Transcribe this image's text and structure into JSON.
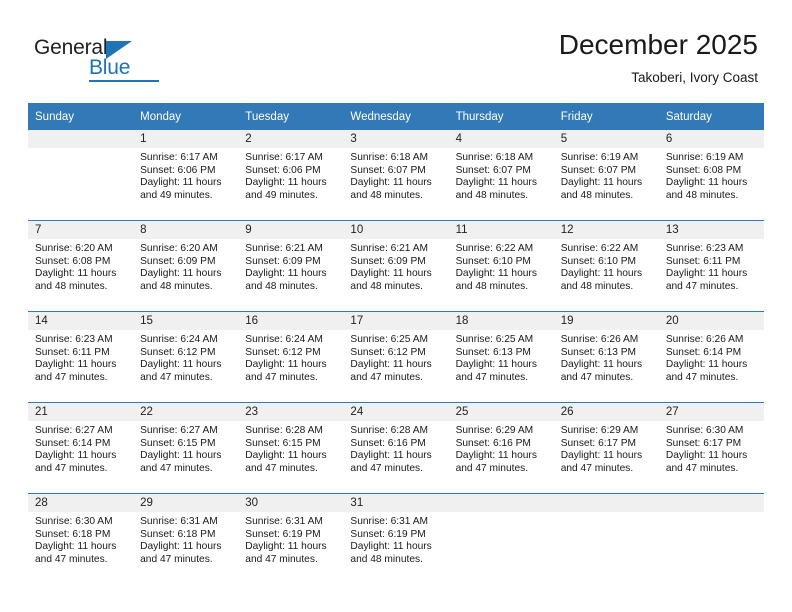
{
  "logo": {
    "word_top": "General",
    "word_bottom": "Blue",
    "accent_color": "#1f73b7",
    "triangle_icon": "triangle-icon"
  },
  "header": {
    "title": "December 2025",
    "subtitle": "Takoberi, Ivory Coast"
  },
  "calendar": {
    "header_bg": "#3279b7",
    "daynum_bg": "#f0f0f0",
    "weekday_headers": [
      "Sunday",
      "Monday",
      "Tuesday",
      "Wednesday",
      "Thursday",
      "Friday",
      "Saturday"
    ],
    "weeks": [
      [
        {
          "day": "",
          "lines": []
        },
        {
          "day": "1",
          "lines": [
            "Sunrise: 6:17 AM",
            "Sunset: 6:06 PM",
            "Daylight: 11 hours",
            "and 49 minutes."
          ]
        },
        {
          "day": "2",
          "lines": [
            "Sunrise: 6:17 AM",
            "Sunset: 6:06 PM",
            "Daylight: 11 hours",
            "and 49 minutes."
          ]
        },
        {
          "day": "3",
          "lines": [
            "Sunrise: 6:18 AM",
            "Sunset: 6:07 PM",
            "Daylight: 11 hours",
            "and 48 minutes."
          ]
        },
        {
          "day": "4",
          "lines": [
            "Sunrise: 6:18 AM",
            "Sunset: 6:07 PM",
            "Daylight: 11 hours",
            "and 48 minutes."
          ]
        },
        {
          "day": "5",
          "lines": [
            "Sunrise: 6:19 AM",
            "Sunset: 6:07 PM",
            "Daylight: 11 hours",
            "and 48 minutes."
          ]
        },
        {
          "day": "6",
          "lines": [
            "Sunrise: 6:19 AM",
            "Sunset: 6:08 PM",
            "Daylight: 11 hours",
            "and 48 minutes."
          ]
        }
      ],
      [
        {
          "day": "7",
          "lines": [
            "Sunrise: 6:20 AM",
            "Sunset: 6:08 PM",
            "Daylight: 11 hours",
            "and 48 minutes."
          ]
        },
        {
          "day": "8",
          "lines": [
            "Sunrise: 6:20 AM",
            "Sunset: 6:09 PM",
            "Daylight: 11 hours",
            "and 48 minutes."
          ]
        },
        {
          "day": "9",
          "lines": [
            "Sunrise: 6:21 AM",
            "Sunset: 6:09 PM",
            "Daylight: 11 hours",
            "and 48 minutes."
          ]
        },
        {
          "day": "10",
          "lines": [
            "Sunrise: 6:21 AM",
            "Sunset: 6:09 PM",
            "Daylight: 11 hours",
            "and 48 minutes."
          ]
        },
        {
          "day": "11",
          "lines": [
            "Sunrise: 6:22 AM",
            "Sunset: 6:10 PM",
            "Daylight: 11 hours",
            "and 48 minutes."
          ]
        },
        {
          "day": "12",
          "lines": [
            "Sunrise: 6:22 AM",
            "Sunset: 6:10 PM",
            "Daylight: 11 hours",
            "and 48 minutes."
          ]
        },
        {
          "day": "13",
          "lines": [
            "Sunrise: 6:23 AM",
            "Sunset: 6:11 PM",
            "Daylight: 11 hours",
            "and 47 minutes."
          ]
        }
      ],
      [
        {
          "day": "14",
          "lines": [
            "Sunrise: 6:23 AM",
            "Sunset: 6:11 PM",
            "Daylight: 11 hours",
            "and 47 minutes."
          ]
        },
        {
          "day": "15",
          "lines": [
            "Sunrise: 6:24 AM",
            "Sunset: 6:12 PM",
            "Daylight: 11 hours",
            "and 47 minutes."
          ]
        },
        {
          "day": "16",
          "lines": [
            "Sunrise: 6:24 AM",
            "Sunset: 6:12 PM",
            "Daylight: 11 hours",
            "and 47 minutes."
          ]
        },
        {
          "day": "17",
          "lines": [
            "Sunrise: 6:25 AM",
            "Sunset: 6:12 PM",
            "Daylight: 11 hours",
            "and 47 minutes."
          ]
        },
        {
          "day": "18",
          "lines": [
            "Sunrise: 6:25 AM",
            "Sunset: 6:13 PM",
            "Daylight: 11 hours",
            "and 47 minutes."
          ]
        },
        {
          "day": "19",
          "lines": [
            "Sunrise: 6:26 AM",
            "Sunset: 6:13 PM",
            "Daylight: 11 hours",
            "and 47 minutes."
          ]
        },
        {
          "day": "20",
          "lines": [
            "Sunrise: 6:26 AM",
            "Sunset: 6:14 PM",
            "Daylight: 11 hours",
            "and 47 minutes."
          ]
        }
      ],
      [
        {
          "day": "21",
          "lines": [
            "Sunrise: 6:27 AM",
            "Sunset: 6:14 PM",
            "Daylight: 11 hours",
            "and 47 minutes."
          ]
        },
        {
          "day": "22",
          "lines": [
            "Sunrise: 6:27 AM",
            "Sunset: 6:15 PM",
            "Daylight: 11 hours",
            "and 47 minutes."
          ]
        },
        {
          "day": "23",
          "lines": [
            "Sunrise: 6:28 AM",
            "Sunset: 6:15 PM",
            "Daylight: 11 hours",
            "and 47 minutes."
          ]
        },
        {
          "day": "24",
          "lines": [
            "Sunrise: 6:28 AM",
            "Sunset: 6:16 PM",
            "Daylight: 11 hours",
            "and 47 minutes."
          ]
        },
        {
          "day": "25",
          "lines": [
            "Sunrise: 6:29 AM",
            "Sunset: 6:16 PM",
            "Daylight: 11 hours",
            "and 47 minutes."
          ]
        },
        {
          "day": "26",
          "lines": [
            "Sunrise: 6:29 AM",
            "Sunset: 6:17 PM",
            "Daylight: 11 hours",
            "and 47 minutes."
          ]
        },
        {
          "day": "27",
          "lines": [
            "Sunrise: 6:30 AM",
            "Sunset: 6:17 PM",
            "Daylight: 11 hours",
            "and 47 minutes."
          ]
        }
      ],
      [
        {
          "day": "28",
          "lines": [
            "Sunrise: 6:30 AM",
            "Sunset: 6:18 PM",
            "Daylight: 11 hours",
            "and 47 minutes."
          ]
        },
        {
          "day": "29",
          "lines": [
            "Sunrise: 6:31 AM",
            "Sunset: 6:18 PM",
            "Daylight: 11 hours",
            "and 47 minutes."
          ]
        },
        {
          "day": "30",
          "lines": [
            "Sunrise: 6:31 AM",
            "Sunset: 6:19 PM",
            "Daylight: 11 hours",
            "and 47 minutes."
          ]
        },
        {
          "day": "31",
          "lines": [
            "Sunrise: 6:31 AM",
            "Sunset: 6:19 PM",
            "Daylight: 11 hours",
            "and 48 minutes."
          ]
        },
        {
          "day": "",
          "lines": []
        },
        {
          "day": "",
          "lines": []
        },
        {
          "day": "",
          "lines": []
        }
      ]
    ]
  }
}
